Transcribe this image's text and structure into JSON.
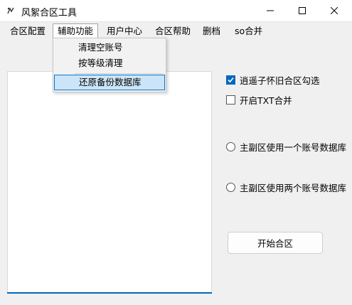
{
  "window": {
    "title": "风絮合区工具"
  },
  "menu": [
    {
      "label": "合区配置",
      "name": "menu-merge-config"
    },
    {
      "label": "辅助功能",
      "name": "menu-auxiliary"
    },
    {
      "label": "用户中心",
      "name": "menu-user-center"
    },
    {
      "label": "合区帮助",
      "name": "menu-merge-help"
    },
    {
      "label": "删档",
      "name": "menu-delete-archive"
    },
    {
      "label": "so合并",
      "name": "menu-so-merge"
    }
  ],
  "dropdown": {
    "items": [
      {
        "label": "清理空账号"
      },
      {
        "label": "按等级清理"
      },
      {
        "label": "还原备份数据库",
        "highlighted": true
      }
    ]
  },
  "options": {
    "checkbox1": {
      "label": "逍遥子怀旧合区勾选",
      "checked": true
    },
    "checkbox2": {
      "label": "开启TXT合并",
      "checked": false
    },
    "radio1": {
      "label": "主副区使用一个账号数据库",
      "selected": false
    },
    "radio2": {
      "label": "主副区使用两个账号数据库",
      "selected": false
    }
  },
  "start_button": {
    "label": "开始合区"
  },
  "colors": {
    "accent": "#0067c0",
    "highlight": "#cce4f7"
  }
}
